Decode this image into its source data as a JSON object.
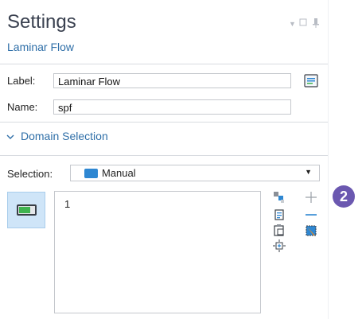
{
  "settings": {
    "title": "Settings",
    "subtitle": "Laminar Flow"
  },
  "fields": {
    "label_caption": "Label:",
    "label_value": "Laminar Flow",
    "name_caption": "Name:",
    "name_value": "spf"
  },
  "domain_selection": {
    "section_title": "Domain Selection",
    "selection_caption": "Selection:",
    "selection_value": "Manual",
    "items": [
      "1"
    ]
  },
  "badge": {
    "number": "2",
    "color": "#6b58b0"
  },
  "colors": {
    "accent": "#2f6fa8",
    "manual_swatch": "#2e87d2",
    "toggle_fill": "#cfe5f8"
  },
  "icons": [
    "pin-icon",
    "maximize-icon",
    "minimize-icon",
    "show-in-list-icon",
    "domain-toggle-icon",
    "copy-selection-icon",
    "paste-selection-icon",
    "zoom-to-selection-icon",
    "add-icon",
    "remove-icon",
    "clear-selection-icon",
    "chevron-down-icon"
  ]
}
